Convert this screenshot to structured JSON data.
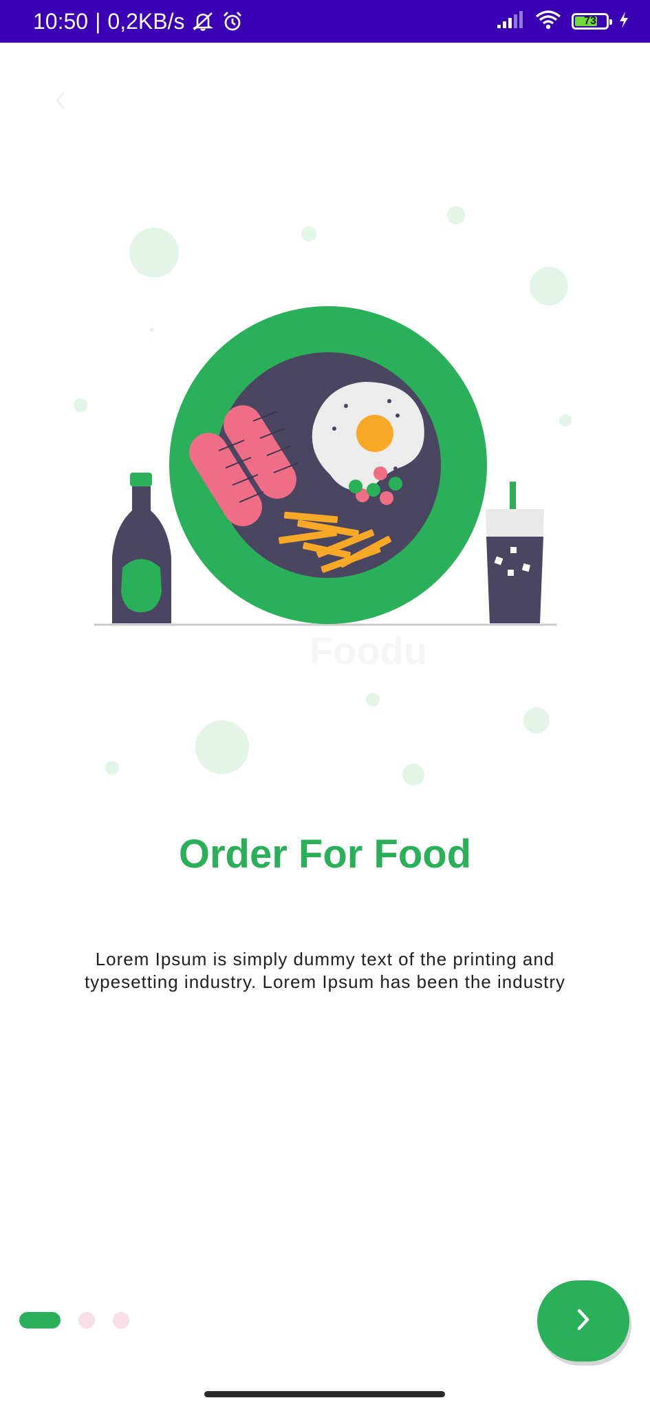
{
  "status_bar": {
    "time": "10:50",
    "network_speed": "0,2KB/s",
    "battery_level": "73",
    "icons": [
      "mute-icon",
      "alarm-icon",
      "signal-icon",
      "wifi-icon",
      "battery-icon",
      "charging-icon"
    ],
    "background_color": "#3c00b4"
  },
  "onboarding": {
    "title": "Order For Food",
    "description_line1": "Lorem Ipsum is simply dummy text of the printing and",
    "description_line2": "typesetting industry. Lorem Ipsum has been the industry",
    "page_count": 3,
    "active_page": 1
  },
  "colors": {
    "accent": "#2bb05a",
    "inactive_dot": "#f6dfe7",
    "plate_inner": "#4a4560"
  },
  "icons": {
    "back": "chevron-left-icon",
    "next": "chevron-right-icon"
  }
}
